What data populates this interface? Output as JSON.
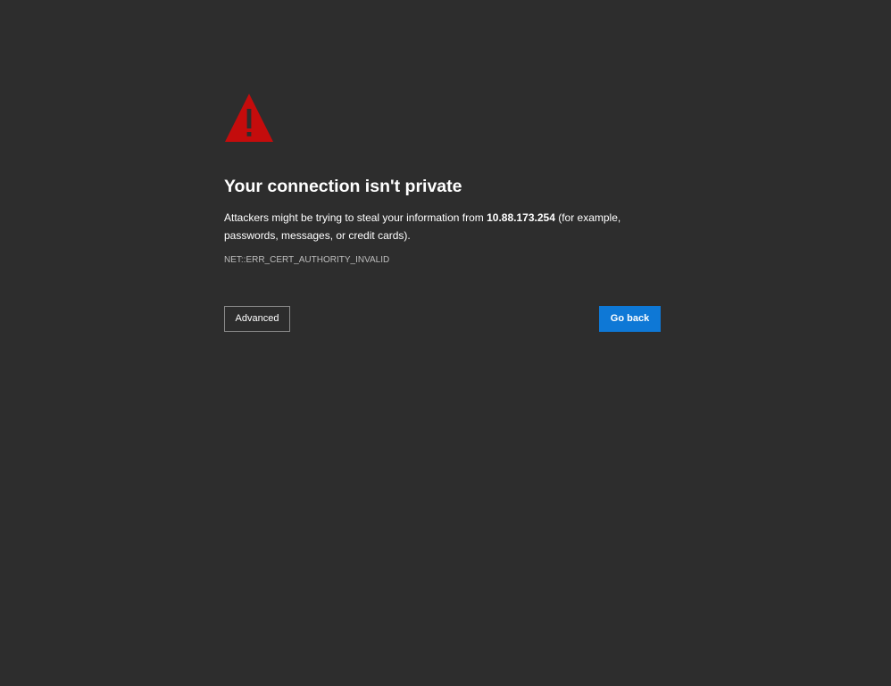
{
  "page": {
    "background_color": "#2d2d2d"
  },
  "warning": {
    "icon": "warning-triangle-icon",
    "icon_color": "#c40c0c"
  },
  "title": "Your connection isn't private",
  "description": {
    "before_host": "Attackers might be trying to steal your information from ",
    "host": "10.88.173.254",
    "after_host": " (for example, passwords, messages, or credit cards)."
  },
  "error_code": "NET::ERR_CERT_AUTHORITY_INVALID",
  "buttons": {
    "advanced_label": "Advanced",
    "go_back_label": "Go back",
    "go_back_color": "#0e78d6"
  }
}
